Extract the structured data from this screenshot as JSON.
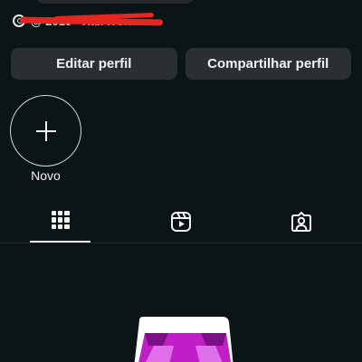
{
  "profile": {
    "threads_text": "@ 2019 - Hall Ivone"
  },
  "actions": {
    "edit_profile": "Editar perfil",
    "share_profile": "Compartilhar perfil"
  },
  "stories": {
    "new_label": "Novo"
  },
  "tabs": [
    {
      "name": "posts-grid",
      "icon": "grid-icon",
      "active": true
    },
    {
      "name": "reels",
      "icon": "reels-icon",
      "active": false
    },
    {
      "name": "tagged",
      "icon": "tagged-person-icon",
      "active": false
    }
  ],
  "colors": {
    "background": "#0b1416",
    "button": "#2a2f33",
    "redaction": "#e8261f",
    "illustration_accent": "#c01fc7"
  }
}
